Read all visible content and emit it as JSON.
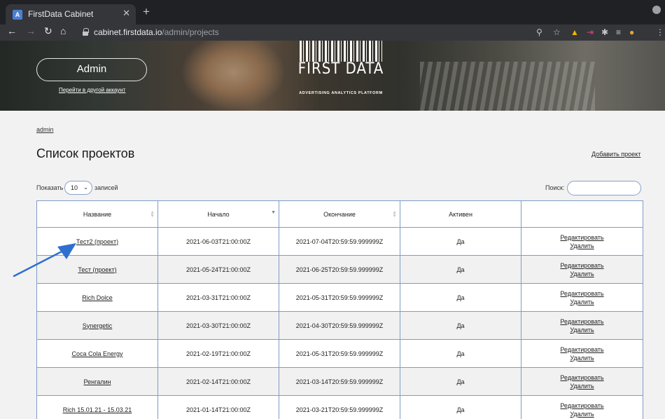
{
  "browser": {
    "tab_title": "FirstData Cabinet",
    "tab_favicon": "A",
    "url_host": "cabinet.firstdata.io",
    "url_path": "/admin/projects"
  },
  "header": {
    "account_label": "Admin",
    "switch_account_label": "Перейти в другой аккаунт",
    "logo_text": "FIRST DATA",
    "logo_subtitle": "ADVERTISING ANALYTICS PLATFORM"
  },
  "breadcrumb": "admin",
  "page_title": "Список проектов",
  "add_project_label": "Добавить проект",
  "table_controls": {
    "show_label": "Показать",
    "length_value": "10",
    "entries_label": "записей",
    "search_label": "Поиск:",
    "search_value": ""
  },
  "table": {
    "columns": [
      "Название",
      "Начало",
      "Окончание",
      "Активен",
      ""
    ],
    "rows": [
      {
        "name": "Тест2 (проект)",
        "start": "2021-06-03T21:00:00Z",
        "end": "2021-07-04T20:59:59.999999Z",
        "active": "Да",
        "edit": "Редактировать",
        "delete": "Удалить"
      },
      {
        "name": "Тест (проект)",
        "start": "2021-05-24T21:00:00Z",
        "end": "2021-06-25T20:59:59.999999Z",
        "active": "Да",
        "edit": "Редактировать",
        "delete": "Удалить"
      },
      {
        "name": "Rich Dolce",
        "start": "2021-03-31T21:00:00Z",
        "end": "2021-05-31T20:59:59.999999Z",
        "active": "Да",
        "edit": "Редактировать",
        "delete": "Удалить"
      },
      {
        "name": "Synergetic",
        "start": "2021-03-30T21:00:00Z",
        "end": "2021-04-30T20:59:59.999999Z",
        "active": "Да",
        "edit": "Редактировать",
        "delete": "Удалить"
      },
      {
        "name": "Coca Cola Energy",
        "start": "2021-02-19T21:00:00Z",
        "end": "2021-05-31T20:59:59.999999Z",
        "active": "Да",
        "edit": "Редактировать",
        "delete": "Удалить"
      },
      {
        "name": "Ренгалин",
        "start": "2021-02-14T21:00:00Z",
        "end": "2021-03-14T20:59:59.999999Z",
        "active": "Да",
        "edit": "Редактировать",
        "delete": "Удалить"
      },
      {
        "name": "Rich 15.01.21 - 15.03.21",
        "start": "2021-01-14T21:00:00Z",
        "end": "2021-03-21T20:59:59.999999Z",
        "active": "Да",
        "edit": "Редактировать",
        "delete": "Удалить"
      }
    ]
  },
  "colors": {
    "table_border": "#7f9cc6",
    "arrow": "#2f6fd0",
    "chrome_dark": "#202124"
  }
}
